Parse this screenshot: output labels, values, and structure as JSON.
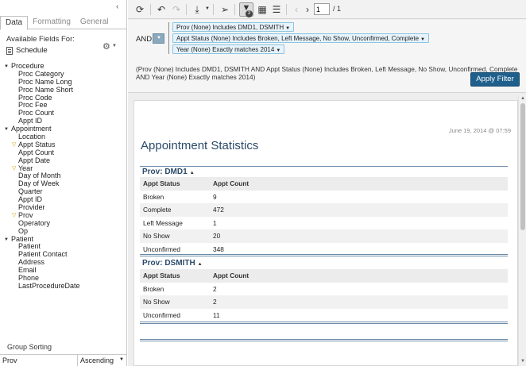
{
  "left_panel": {
    "tabs": [
      {
        "label": "Data"
      },
      {
        "label": "Formatting"
      },
      {
        "label": "General"
      }
    ],
    "available_fields_label": "Available Fields For:",
    "source": "Schedule",
    "icons": {
      "collapse": "chevron-left-icon",
      "gear": "gear-icon",
      "source": "document-icon",
      "filter": "funnel-icon"
    },
    "tree": [
      {
        "label": "Procedure",
        "type": "category"
      },
      {
        "label": "Proc Category",
        "type": "leaf"
      },
      {
        "label": "Proc Name Long",
        "type": "leaf"
      },
      {
        "label": "Proc Name Short",
        "type": "leaf"
      },
      {
        "label": "Proc Code",
        "type": "leaf"
      },
      {
        "label": "Proc Fee",
        "type": "leaf"
      },
      {
        "label": "Proc Count",
        "type": "leaf"
      },
      {
        "label": "Appt ID",
        "type": "leaf"
      },
      {
        "label": "Appointment",
        "type": "category"
      },
      {
        "label": "Location",
        "type": "leaf"
      },
      {
        "label": "Appt Status",
        "type": "leaf",
        "filtered": true
      },
      {
        "label": "Appt Count",
        "type": "leaf"
      },
      {
        "label": "Appt Date",
        "type": "leaf"
      },
      {
        "label": "Year",
        "type": "leaf",
        "filtered": true
      },
      {
        "label": "Day of Month",
        "type": "leaf"
      },
      {
        "label": "Day of Week",
        "type": "leaf"
      },
      {
        "label": "Quarter",
        "type": "leaf"
      },
      {
        "label": "Appt ID",
        "type": "leaf"
      },
      {
        "label": "Provider",
        "type": "leaf"
      },
      {
        "label": "Prov",
        "type": "leaf",
        "filtered": true
      },
      {
        "label": "Operatory",
        "type": "leaf"
      },
      {
        "label": "Op",
        "type": "leaf"
      },
      {
        "label": "Patient",
        "type": "category"
      },
      {
        "label": "Patient",
        "type": "leaf"
      },
      {
        "label": "Patient Contact",
        "type": "leaf"
      },
      {
        "label": "Address",
        "type": "leaf"
      },
      {
        "label": "Email",
        "type": "leaf"
      },
      {
        "label": "Phone",
        "type": "leaf"
      },
      {
        "label": "LastProcedureDate",
        "type": "leaf"
      }
    ],
    "group_sorting_label": "Group Sorting",
    "group_field": "Prov",
    "sort_order": "Ascending"
  },
  "toolbar": {
    "page_current": "1",
    "page_total": "/ 1",
    "active_badge": "3"
  },
  "filters": {
    "operator": "AND",
    "chips": [
      "Prov (None) Includes DMD1, DSMITH",
      "Appt Status (None) Includes Broken, Left Message, No Show, Unconfirmed, Complete",
      "Year (None) Exactly matches 2014"
    ],
    "summary": "(Prov (None) Includes DMD1, DSMITH AND Appt Status (None) Includes Broken, Left Message, No Show, Unconfirmed, Complete AND Year (None) Exactly matches 2014)",
    "apply_label": "Apply Filter"
  },
  "report": {
    "timestamp": "June 19, 2014 @ 07:59",
    "title": "Appointment Statistics",
    "columns": [
      "Appt Status",
      "Appt Count"
    ],
    "groups": [
      {
        "name": "Prov: DMD1",
        "rows": [
          [
            "Broken",
            "9"
          ],
          [
            "Complete",
            "472"
          ],
          [
            "Left Message",
            "1"
          ],
          [
            "No Show",
            "20"
          ],
          [
            "Unconfirmed",
            "348"
          ]
        ]
      },
      {
        "name": "Prov: DSMITH",
        "rows": [
          [
            "Broken",
            "2"
          ],
          [
            "No Show",
            "2"
          ],
          [
            "Unconfirmed",
            "11"
          ]
        ]
      }
    ]
  }
}
